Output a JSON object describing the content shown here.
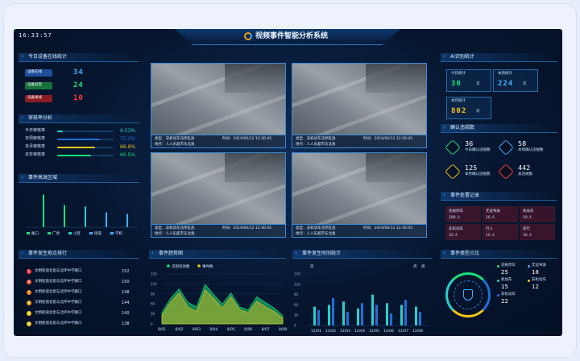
{
  "clock": "16:33:57",
  "app_title": "视频事件智能分析系统",
  "colors": {
    "accent": "#3fb0ff",
    "green": "#19e07a",
    "yellow": "#f0c419",
    "red": "#ff3b3b",
    "cyan": "#26d0ce",
    "blue": "#1e6fd9"
  },
  "online": {
    "title": "今日设备在线统计",
    "rows": [
      {
        "label": "设备在线",
        "value": "34",
        "color": "#1e6fd9",
        "text": "#3fb0ff"
      },
      {
        "label": "设备异常",
        "value": "24",
        "color": "#19a04a",
        "text": "#19e07a"
      },
      {
        "label": "设备离线",
        "value": "10",
        "color": "#c0282a",
        "text": "#ff3b3b"
      }
    ]
  },
  "audit": {
    "title": "审核率分析",
    "rows": [
      {
        "label": "今日审核率",
        "value": "9.53%",
        "pct": 9.53,
        "color": "#26d0ce"
      },
      {
        "label": "本周审核率",
        "value": "75.3%",
        "pct": 75.3,
        "color": "#1e6fd9"
      },
      {
        "label": "本月审核率",
        "value": "66.9%",
        "pct": 66.9,
        "color": "#f0c419"
      },
      {
        "label": "本年审核率",
        "value": "60.5%",
        "pct": 60.5,
        "color": "#19e07a"
      }
    ]
  },
  "region": {
    "title": "事件高发区域",
    "legend": [
      "路口",
      "广场",
      "小区",
      "街道",
      "学校"
    ],
    "values": [
      44,
      30,
      28,
      20,
      18
    ],
    "max": 50
  },
  "videos": [
    {
      "type": "类型：非机动车违停乱放",
      "time": "时间：2019/06/12 12:30:45",
      "place": "地点：人人乐超市东北角"
    },
    {
      "type": "类型：非机动车违停乱放",
      "time": "时间：2019/06/12 12:30:45",
      "place": "地点：人人乐超市东北角"
    },
    {
      "type": "类型：非机动车违停乱放",
      "time": "时间：2019/06/12 12:30:45",
      "place": "地点：人人乐超市东北角"
    },
    {
      "type": "类型：非机动车违停乱放",
      "time": "时间：2019/06/12 12:30:45",
      "place": "地点：人人乐超市东北角"
    }
  ],
  "ai": {
    "title": "AI识别统计",
    "boxes": [
      {
        "label": "今日统计",
        "value": "30",
        "unit": "次",
        "color": "#19e07a"
      },
      {
        "label": "本周统计",
        "value": "224",
        "unit": "次",
        "color": "#3fb0ff"
      },
      {
        "label": "本月统计",
        "value": "802",
        "unit": "次",
        "color": "#f0c419"
      }
    ]
  },
  "confirm": {
    "title": "确认违规数",
    "items": [
      {
        "value": "36",
        "label": "今日确认违规数",
        "color": "#19e07a"
      },
      {
        "value": "58",
        "label": "本周确认违规数",
        "color": "#3fb0ff"
      },
      {
        "value": "125",
        "label": "本月确认违规数",
        "color": "#f0c419"
      },
      {
        "value": "442",
        "label": "总违规数",
        "color": "#ff3b3b"
      }
    ]
  },
  "handle": {
    "title": "事件处置记录",
    "cells": [
      {
        "name": "违规停车",
        "count": "200 人"
      },
      {
        "name": "无证驾驶",
        "count": "10 人"
      },
      {
        "name": "机动车",
        "count": "10 人"
      },
      {
        "name": "非机动车",
        "count": "10 人"
      },
      {
        "name": "行人",
        "count": "10 人"
      },
      {
        "name": "逆行",
        "count": "10 人"
      }
    ]
  },
  "ranking": {
    "title": "事件发生地点排行",
    "items": [
      {
        "no": "1",
        "text": "文明街道北街与北环中学路口",
        "value": "152",
        "color": "#ff3b3b"
      },
      {
        "no": "2",
        "text": "文明街道北街与北环中学路口",
        "value": "150",
        "color": "#ff5a3b"
      },
      {
        "no": "3",
        "text": "文明街道北街与北环中学路口",
        "value": "148",
        "color": "#f07a19"
      },
      {
        "no": "4",
        "text": "文明街道北街与北环中学路口",
        "value": "144",
        "color": "#f0a019"
      },
      {
        "no": "5",
        "text": "文明街道北街与北环中学路口",
        "value": "140",
        "color": "#f0c419"
      },
      {
        "no": "6",
        "text": "文明街道北街与北环中学路口",
        "value": "138",
        "color": "#f0c419"
      }
    ]
  },
  "trend": {
    "title": "事件趋势图",
    "legend": [
      "识别有效数",
      "事件数"
    ],
    "legend_colors": [
      "#19e07a",
      "#f0c419"
    ],
    "x": [
      "8/01",
      "8/02",
      "8/03",
      "8/04",
      "8/05",
      "8/06",
      "8/07",
      "8/08"
    ],
    "yticks": [
      "150",
      "120",
      "90",
      "60",
      "30",
      "0"
    ],
    "valid": [
      20,
      45,
      62,
      38,
      30,
      70,
      52,
      35,
      55,
      30,
      25,
      48,
      38,
      28,
      15
    ],
    "events": [
      15,
      38,
      55,
      30,
      22,
      60,
      45,
      28,
      48,
      25,
      20,
      40,
      30,
      22,
      10
    ]
  },
  "time": {
    "title": "事件发生时间统计",
    "tabs": [
      "日",
      "月",
      "周"
    ],
    "x": [
      "12/01",
      "12/02",
      "12/03",
      "12/04",
      "12/05",
      "12/06",
      "12/07",
      "12/08"
    ],
    "yticks": [
      "150",
      "120",
      "90",
      "60",
      "30",
      "0"
    ],
    "a": [
      55,
      60,
      70,
      50,
      90,
      65,
      60,
      55
    ],
    "b": [
      45,
      80,
      40,
      65,
      60,
      35,
      75,
      40
    ]
  },
  "types": {
    "title": "事件类型占比",
    "items": [
      {
        "label": "违规停车",
        "value": "25",
        "color": "#19e07a"
      },
      {
        "label": "无证驾驶",
        "value": "18",
        "color": "#3fb0ff"
      },
      {
        "label": "机动车",
        "value": "15",
        "color": "#26d0ce"
      },
      {
        "label": "非机动车",
        "value": "12",
        "color": "#f0c419"
      },
      {
        "label": "非机动车",
        "value": "22",
        "color": "#1e6fd9"
      }
    ]
  }
}
